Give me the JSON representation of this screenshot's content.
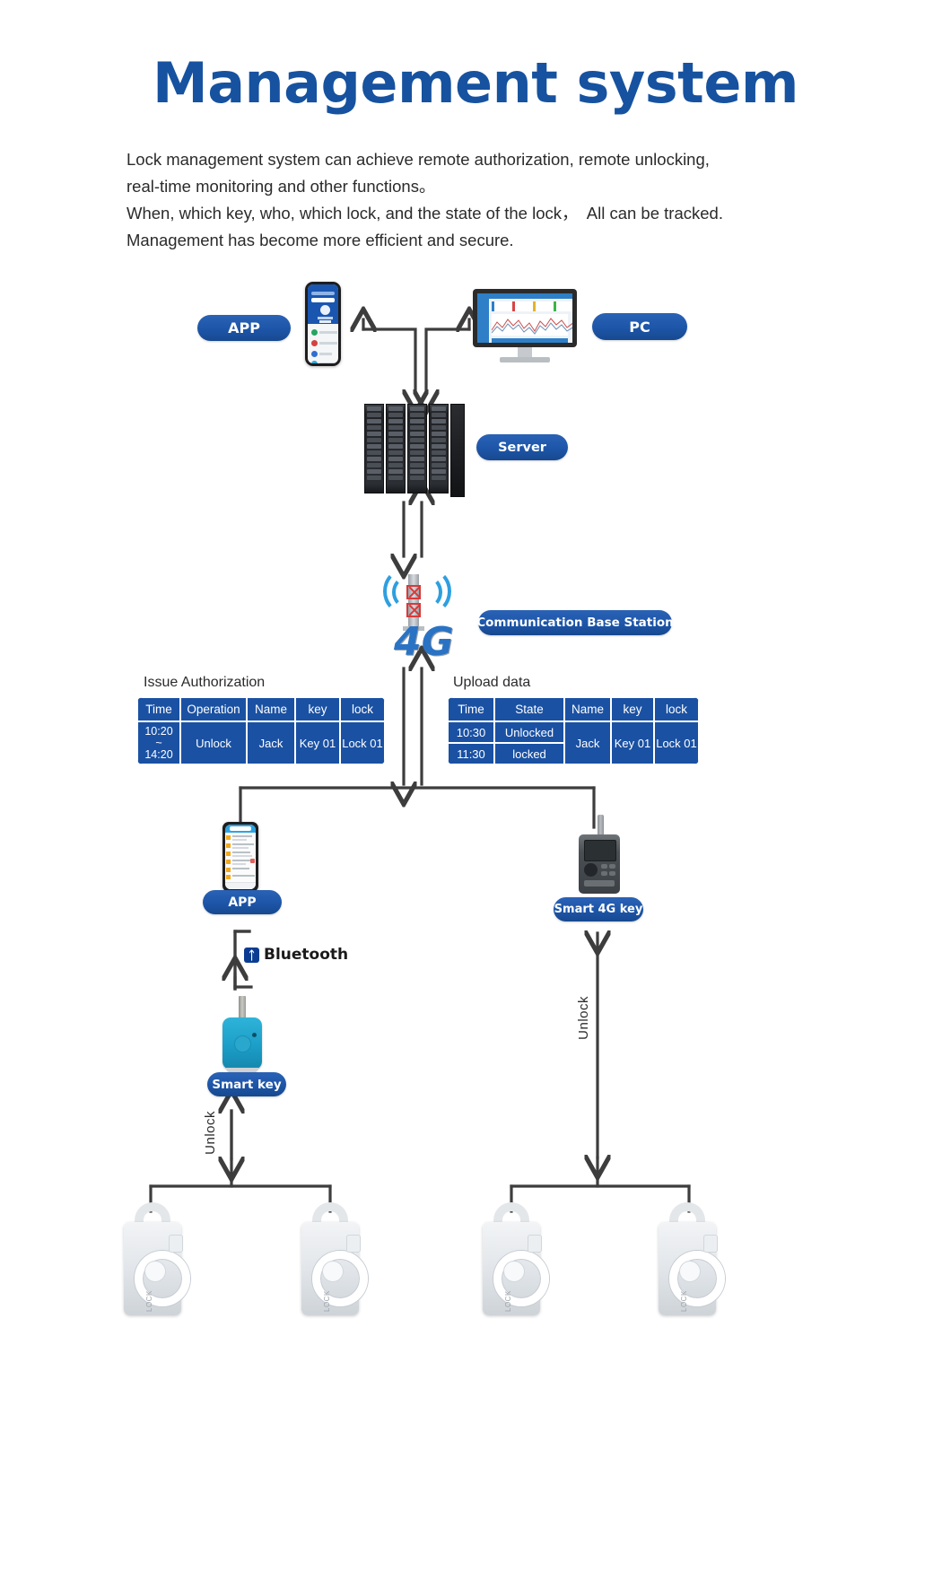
{
  "page": {
    "title": "Management system",
    "accent_color": "#16529f",
    "badge_color": "#1d55a8",
    "table_color": "#1a51a3"
  },
  "description": {
    "line1": "Lock management system can achieve remote authorization, remote unlocking,",
    "line2": "real-time monitoring and other functions。",
    "line3": "When, which key, who, which lock, and the state of the lock，  All can be tracked.",
    "line4": "Management has become more efficient and secure."
  },
  "badges": {
    "app_top": "APP",
    "pc": "PC",
    "server": "Server",
    "base_station": "Communication Base Station",
    "app_bottom": "APP",
    "smart_4g_key": "Smart 4G key",
    "smart_key": "Smart key"
  },
  "labels": {
    "issue_authorization": "Issue Authorization",
    "upload_data": "Upload data",
    "bluetooth": "Bluetooth",
    "unlock_left": "Unlock",
    "unlock_right": "Unlock",
    "tower_4g": "4G"
  },
  "tables": {
    "issue": {
      "caption": "Issue Authorization",
      "headers": [
        "Time",
        "Operation",
        "Name",
        "key",
        "lock"
      ],
      "rows": [
        {
          "time_from": "10:20",
          "time_sep": "~",
          "time_to": "14:20",
          "operation": "Unlock",
          "name": "Jack",
          "key": "Key 01",
          "lock": "Lock 01"
        }
      ]
    },
    "upload": {
      "caption": "Upload data",
      "headers": [
        "Time",
        "State",
        "Name",
        "key",
        "lock"
      ],
      "rows": [
        {
          "time": "10:30",
          "state": "Unlocked"
        },
        {
          "time": "11:30",
          "state": "locked"
        }
      ],
      "name": "Jack",
      "key": "Key 01",
      "lock": "Lock 01"
    }
  },
  "devices": {
    "phone_top": "smartphone-app-icon",
    "monitor": "desktop-monitor-icon",
    "server_rack": "server-rack-icon",
    "tower": "4g-base-station-icon",
    "phone_bottom": "smartphone-app-icon",
    "handheld": "smart-4g-key-device-icon",
    "keyfob": "smart-key-fob-icon",
    "padlocks": [
      "padlock-icon",
      "padlock-icon",
      "padlock-icon",
      "padlock-icon"
    ],
    "padlock_brand": "LOCK"
  }
}
